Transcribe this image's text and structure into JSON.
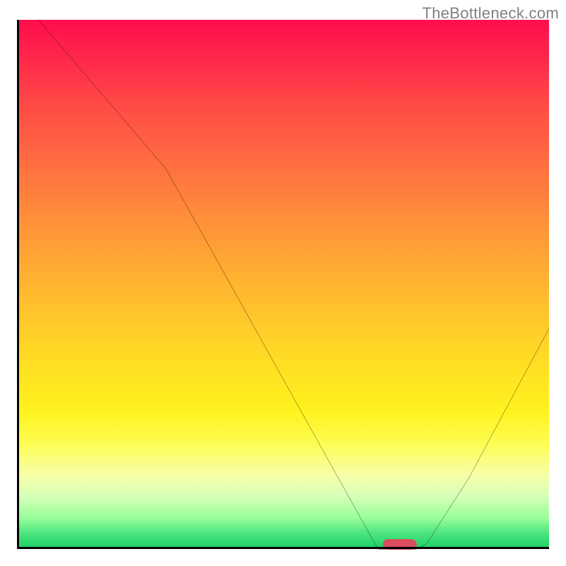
{
  "watermark": "TheBottleneck.com",
  "chart_data": {
    "type": "line",
    "x_range": [
      0,
      100
    ],
    "y_range": [
      0,
      100
    ],
    "title": "",
    "xlabel": "",
    "ylabel": "",
    "series": [
      {
        "name": "curve",
        "points": [
          {
            "x": 4,
            "y": 100
          },
          {
            "x": 28,
            "y": 72
          },
          {
            "x": 62,
            "y": 11
          },
          {
            "x": 67,
            "y": 2
          },
          {
            "x": 68,
            "y": 0.5
          },
          {
            "x": 75,
            "y": 0.5
          },
          {
            "x": 77,
            "y": 1.5
          },
          {
            "x": 85,
            "y": 14
          },
          {
            "x": 100,
            "y": 42
          }
        ]
      }
    ],
    "marker": {
      "x": 72,
      "y": 0.8
    },
    "background_gradient": {
      "stops": [
        {
          "pct": 0,
          "color": "#ff0d4d"
        },
        {
          "pct": 50,
          "color": "#ffb030"
        },
        {
          "pct": 80,
          "color": "#fff94f"
        },
        {
          "pct": 100,
          "color": "#19cf65"
        }
      ]
    }
  }
}
